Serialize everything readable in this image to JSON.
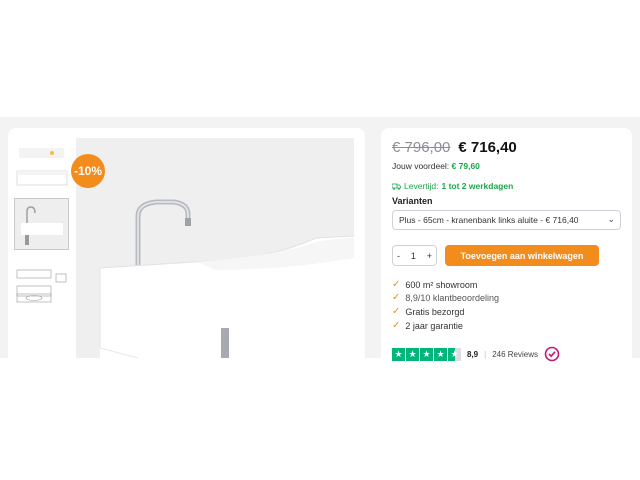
{
  "badge": {
    "discount": "-10%"
  },
  "pricing": {
    "old_price": "€ 796,00",
    "new_price": "€ 716,40",
    "savings_label": "Jouw voordeel:",
    "savings_amount": "€ 79,60"
  },
  "delivery": {
    "label": "Levertijd:",
    "value": "1 tot 2 werkdagen"
  },
  "variants": {
    "label": "Varianten",
    "selected": "Plus - 65cm - kranenbank links aluite - € 716,40"
  },
  "quantity": {
    "minus": "-",
    "value": "1",
    "plus": "+"
  },
  "cart": {
    "button_label": "Toevoegen aan winkelwagen"
  },
  "usps": [
    "600 m² showroom",
    "8,9/10 klantbeoordeling",
    "Gratis bezorgd",
    "2 jaar garantie"
  ],
  "trust": {
    "score": "8,9",
    "reviews": "246 Reviews",
    "rating_stars": 4.5,
    "rating_max": 5
  },
  "colors": {
    "accent": "#f28c1c",
    "success": "#1aa64a",
    "trustpilot": "#00b67a"
  }
}
